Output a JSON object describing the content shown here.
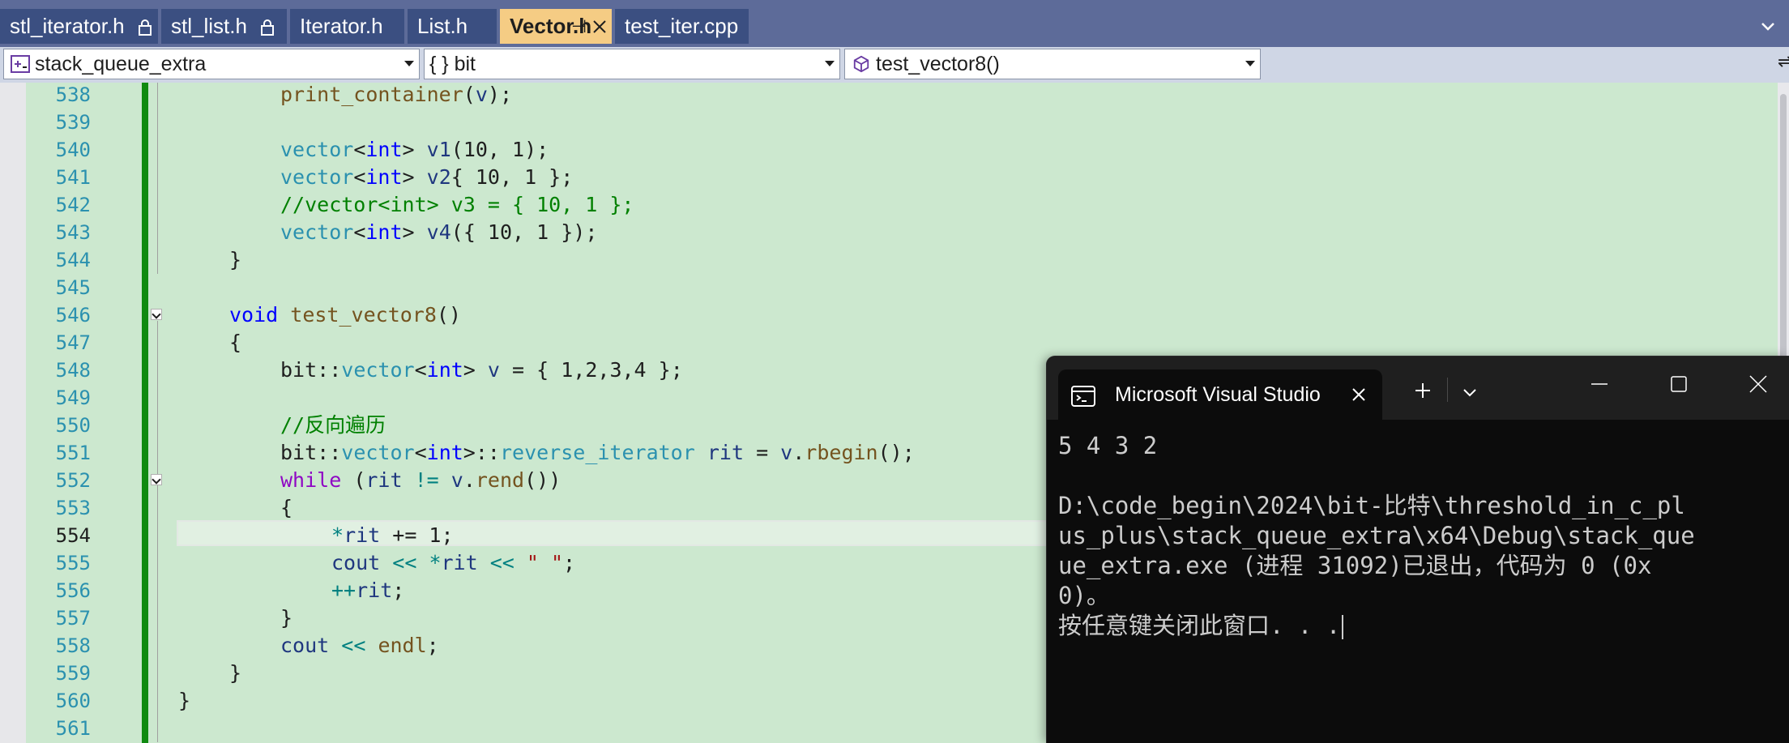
{
  "tabs": [
    {
      "label": "stl_iterator.h",
      "locked": true
    },
    {
      "label": "stl_list.h",
      "locked": true
    },
    {
      "label": "Iterator.h"
    },
    {
      "label": "List.h"
    },
    {
      "label": "Vector.h",
      "active": true
    },
    {
      "label": "test_iter.cpp"
    }
  ],
  "nav": {
    "project": "stack_queue_extra",
    "scope": "{ } bit",
    "member": "test_vector8()"
  },
  "editor": {
    "current_line": "554",
    "lines": [
      {
        "n": "538"
      },
      {
        "n": "539"
      },
      {
        "n": "540"
      },
      {
        "n": "541"
      },
      {
        "n": "542"
      },
      {
        "n": "543"
      },
      {
        "n": "544"
      },
      {
        "n": "545"
      },
      {
        "n": "546"
      },
      {
        "n": "547"
      },
      {
        "n": "548"
      },
      {
        "n": "549"
      },
      {
        "n": "550"
      },
      {
        "n": "551"
      },
      {
        "n": "552"
      },
      {
        "n": "553"
      },
      {
        "n": "554"
      },
      {
        "n": "555"
      },
      {
        "n": "556"
      },
      {
        "n": "557"
      },
      {
        "n": "558"
      },
      {
        "n": "559"
      },
      {
        "n": "560"
      },
      {
        "n": "561"
      }
    ],
    "code": {
      "l538": {
        "fn": "print_container",
        "a": "(",
        "v": "v",
        "b": ");"
      },
      "l540": {
        "t": "vector",
        "lt": "<",
        "k": "int",
        "gt": ">",
        "sp": " ",
        "v": "v1",
        "rest": "(10, 1);"
      },
      "l541": {
        "t": "vector",
        "lt": "<",
        "k": "int",
        "gt": ">",
        "sp": " ",
        "v": "v2",
        "rest": "{ 10, 1 };"
      },
      "l542": {
        "c": "//vector<int> v3 = { 10, 1 };"
      },
      "l543": {
        "t": "vector",
        "lt": "<",
        "k": "int",
        "gt": ">",
        "sp": " ",
        "v": "v4",
        "rest": "({ 10, 1 });"
      },
      "l544": {
        "p": "}"
      },
      "l546": {
        "k": "void",
        "sp": " ",
        "fn": "test_vector8",
        "p": "()"
      },
      "l547": {
        "p": "{"
      },
      "l548": {
        "ns": "bit",
        "sc": "::",
        "t": "vector",
        "lt": "<",
        "k": "int",
        "gt": ">",
        "sp": " ",
        "v": "v",
        "rest": " = { 1,2,3,4 };"
      },
      "l550": {
        "c": "//反向遍历"
      },
      "l551": {
        "ns": "bit",
        "sc": "::",
        "t": "vector",
        "lt": "<",
        "k": "int",
        "gt": ">",
        "sc2": "::",
        "t2": "reverse_iterator",
        "sp": " ",
        "v": "rit",
        "eq": " = ",
        "v2": "v",
        "dot": ".",
        "fn": "rbegin",
        "end": "();"
      },
      "l552": {
        "ctl": "while",
        "a": " (",
        "v": "rit",
        "op": " != ",
        "v2": "v",
        "dot": ".",
        "fn": "rend",
        "end": "())"
      },
      "l553": {
        "p": "{"
      },
      "l554": {
        "op": "*",
        "v": "rit",
        "rest": " += 1;"
      },
      "l555": {
        "v": "cout",
        "op": " << ",
        "op2": "*",
        "v2": "rit",
        "op3": " << ",
        "s": "\" \"",
        "end": ";"
      },
      "l556": {
        "op": "++",
        "v": "rit",
        "end": ";"
      },
      "l557": {
        "p": "}"
      },
      "l558": {
        "v": "cout",
        "op": " << ",
        "fn": "endl",
        "end": ";"
      },
      "l559": {
        "p": "}"
      },
      "l560": {
        "p": "}"
      }
    }
  },
  "console": {
    "title": "Microsoft Visual Studio",
    "lines": [
      "5 4 3 2",
      "",
      "D:\\code_begin\\2024\\bit-比特\\threshold_in_c_pl",
      "us_plus\\stack_queue_extra\\x64\\Debug\\stack_que",
      "ue_extra.exe (进程 31092)已退出，代码为 0 (0x",
      "0)。",
      "按任意键关闭此窗口. . ."
    ]
  },
  "colors": {
    "editor_bg": "#cce8cf",
    "tab_active": "#f5cc84",
    "tab_inactive": "#3b4f81",
    "keyword": "#0000ff",
    "type": "#2b91af",
    "function": "#74531f",
    "comment": "#008000",
    "string": "#a31515",
    "control": "#8f08c4",
    "variable": "#1f377f",
    "change_bar": "#108a10",
    "console_bg": "#0c0c0c"
  },
  "icons": {
    "lock": "lock-icon",
    "pin": "pin-icon",
    "close": "close-icon",
    "dropdown": "chevron-down-icon",
    "project": "project-icon",
    "member": "cube-icon",
    "terminal": "terminal-icon"
  }
}
